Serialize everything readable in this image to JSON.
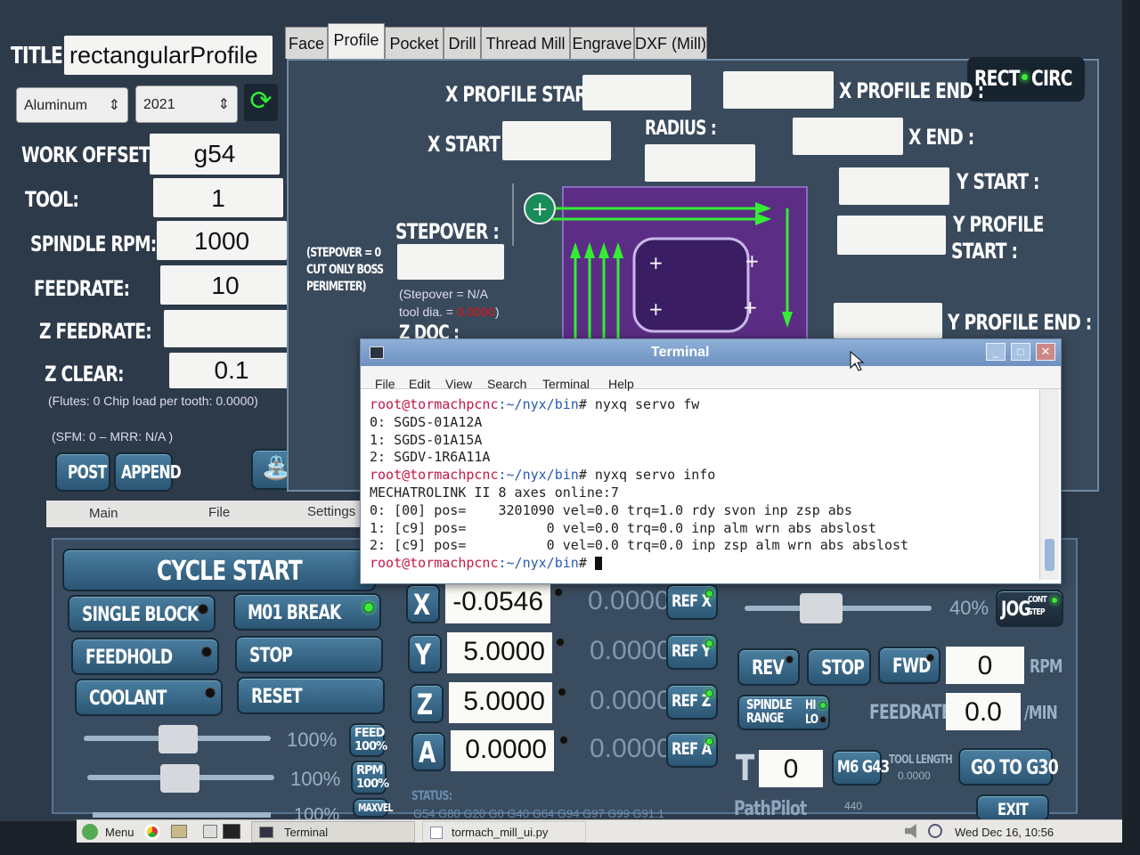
{
  "title_label": "TITLE:",
  "title_value": "rectangularProfile",
  "material": "Aluminum",
  "alloy": "2021",
  "left_fields": [
    {
      "label": "WORK OFFSET:",
      "value": "g54"
    },
    {
      "label": "TOOL:",
      "value": "1"
    },
    {
      "label": "SPINDLE RPM:",
      "value": "1000"
    },
    {
      "label": "FEEDRATE:",
      "value": "10"
    },
    {
      "label": "Z FEEDRATE:",
      "value": ""
    },
    {
      "label": "Z CLEAR:",
      "value": "0.1"
    }
  ],
  "flutes_text": "(Flutes: 0   Chip load per tooth: 0.0000)",
  "sfm_text": "(SFM: 0    –    MRR: N/A )",
  "post_label": "POST",
  "append_label": "APPEND",
  "tabs": [
    "Face",
    "Profile",
    "Pocket",
    "Drill",
    "Thread Mill",
    "Engrave",
    "DXF (Mill)"
  ],
  "active_tab": "Profile",
  "profile": {
    "x_profile_start": "X PROFILE START :",
    "x_profile_end": "X PROFILE END :",
    "x_start": "X START :",
    "radius": "RADIUS :",
    "x_end": "X END :",
    "y_start": "Y START :",
    "y_profile_start_1": "Y PROFILE",
    "y_profile_start_2": "START :",
    "y_profile_end": "Y PROFILE END :",
    "stepover": "STEPOVER :",
    "stepover_note_1": "(STEPOVER = 0",
    "stepover_note_2": "CUT ONLY BOSS",
    "stepover_note_3": "PERIMETER)",
    "stepover_na": "(Stepover = N/A",
    "tool_dia": "tool dia. = ",
    "tool_dia_val": "0.0000",
    "z_doc": "Z DOC :",
    "rect": "RECT",
    "circ": "CIRC"
  },
  "bottom_tabs": [
    "Main",
    "File",
    "Settings"
  ],
  "terminal": {
    "title": "Terminal",
    "menu": [
      "File",
      "Edit",
      "View",
      "Search",
      "Terminal",
      "Help"
    ],
    "prompt_user": "root@tormachpcnc",
    "prompt_path": ":~/nyx/bin",
    "cmd1": "# nyxq servo fw",
    "out1": [
      "0: SGDS-01A12A",
      "1: SGDS-01A15A",
      "2: SGDV-1R6A11A"
    ],
    "cmd2": "# nyxq servo info",
    "out2": [
      "MECHATROLINK II 8 axes online:7",
      "0: [00] pos=    3201090 vel=0.0 trq=1.0 rdy svon inp zsp abs",
      "1: [c9] pos=          0 vel=0.0 trq=0.0 inp alm wrn abs abslost",
      "2: [c9] pos=          0 vel=0.0 trq=0.0 inp zsp alm wrn abs abslost"
    ],
    "cmd3": "# "
  },
  "controls": {
    "cycle_start": "CYCLE START",
    "single_block": "SINGLE BLOCK",
    "m01_break": "M01 BREAK",
    "feedhold": "FEEDHOLD",
    "stop": "STOP",
    "coolant": "COOLANT",
    "reset": "RESET",
    "feed_pct": "100%",
    "rpm_pct": "100%",
    "maxvel_pct": "100%",
    "feed_btn": "FEED 100%",
    "rpm_btn": "RPM 100%",
    "maxvel_btn": "MAXVEL"
  },
  "dro": [
    {
      "axis": "X",
      "value": "-0.0546",
      "dtg": "0.0000",
      "ref": "REF X"
    },
    {
      "axis": "Y",
      "value": "5.0000",
      "dtg": "0.0000",
      "ref": "REF Y"
    },
    {
      "axis": "Z",
      "value": "5.0000",
      "dtg": "0.0000",
      "ref": "REF Z"
    },
    {
      "axis": "A",
      "value": "0.0000",
      "dtg": "0.0000",
      "ref": "REF A"
    }
  ],
  "status_label": "STATUS:",
  "gcodes": "G54 G80 G20 G0 G40 G64 G94 G97 G99 G91.1",
  "spindle": {
    "jog_pct": "40%",
    "jog": "JOG",
    "cont": "CONT",
    "step": "STEP",
    "rev": "REV",
    "stop": "STOP",
    "fwd": "FWD",
    "rpm_value": "0",
    "rpm_unit": "RPM",
    "range_label": "SPINDLE RANGE",
    "hi": "HI",
    "lo": "LO",
    "feedrate_label": "FEEDRATE:",
    "feedrate_value": "0.0",
    "feedrate_unit": "/MIN",
    "t_label": "T",
    "tool_value": "0",
    "m6g43": "M6 G43",
    "tool_length_label": "TOOL LENGTH",
    "tool_length_value": "0.0000",
    "goto_g30": "GO TO G30",
    "exit": "EXIT",
    "brand": "PathPilot",
    "version": "440"
  },
  "taskbar": {
    "menu": "Menu",
    "task1": "Terminal",
    "task2": "tormach_mill_ui.py",
    "clock": "Wed Dec 16, 10:56"
  },
  "colors": {
    "accent_green": "#33dd33",
    "terminal_prompt": "#c4174a",
    "terminal_path": "#2a59b3",
    "diagram_purple": "#5b2d84"
  }
}
